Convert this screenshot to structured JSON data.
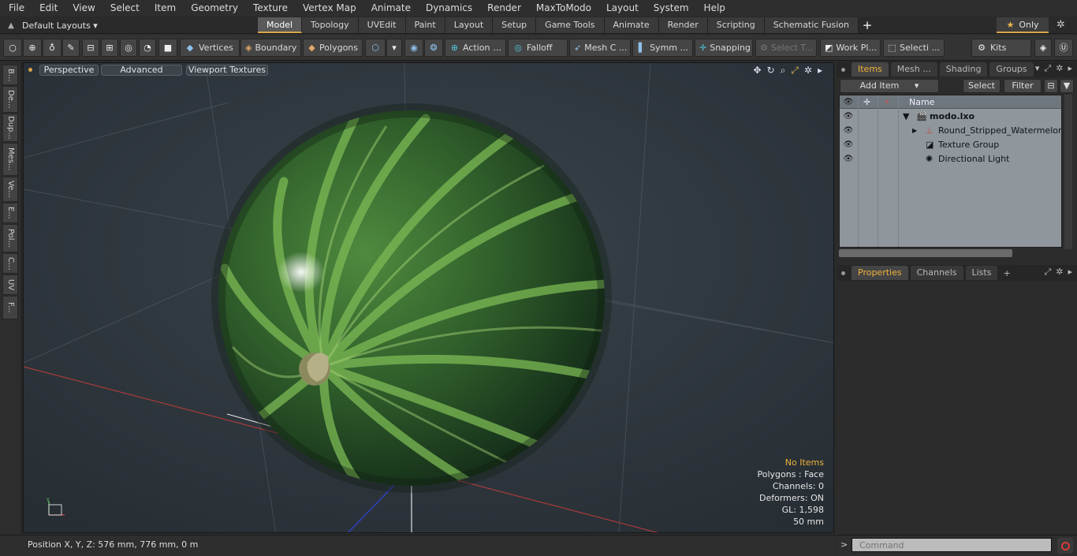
{
  "menu": [
    "File",
    "Edit",
    "View",
    "Select",
    "Item",
    "Geometry",
    "Texture",
    "Vertex Map",
    "Animate",
    "Dynamics",
    "Render",
    "MaxToModo",
    "Layout",
    "System",
    "Help"
  ],
  "layout_menu": {
    "label": "Default Layouts ▾",
    "icon": "layouts-home-icon"
  },
  "tabs": [
    {
      "label": "Model",
      "active": true
    },
    {
      "label": "Topology"
    },
    {
      "label": "UVEdit"
    },
    {
      "label": "Paint"
    },
    {
      "label": "Layout"
    },
    {
      "label": "Setup"
    },
    {
      "label": "Game Tools"
    },
    {
      "label": "Animate"
    },
    {
      "label": "Render"
    },
    {
      "label": "Scripting"
    },
    {
      "label": "Schematic Fusion"
    }
  ],
  "tab_add": "+",
  "only_button": {
    "star": "★",
    "label": "Only"
  },
  "toolbar": {
    "vertices": "Vertices",
    "boundary": "Boundary",
    "polygons": "Polygons",
    "action": "Action",
    "falloff": "Falloff",
    "mesh": "Mesh C ...",
    "symmetry": "Symm ...",
    "snapping": "Snapping",
    "select_through": "Select T...",
    "work_plane": "Work Pl...",
    "selection": "Selecti ...",
    "kits": "Kits",
    "action_more": "..."
  },
  "left_tabs": [
    "B...",
    "De...",
    "Dup...",
    "Mes...",
    "Ve...",
    "E...",
    "Pol...",
    "C...",
    "UV",
    "F..."
  ],
  "viewport": {
    "view_mode": "Perspective",
    "shading": "Advanced",
    "textures": "Viewport Textures",
    "info": {
      "no_items": "No Items",
      "polygons": "Polygons : Face",
      "channels": "Channels: 0",
      "deformers": "Deformers: ON",
      "gl": "GL: 1,598",
      "size": "50 mm"
    },
    "colors": {
      "accent": "#d8a64a",
      "warning": "#f0b23b",
      "background": "#2a3137"
    }
  },
  "status": {
    "position": "Position X, Y, Z:   576 mm, 776 mm, 0 m"
  },
  "items_panel": {
    "tabs": [
      {
        "label": "Items",
        "active": true
      },
      {
        "label": "Mesh ..."
      },
      {
        "label": "Shading"
      },
      {
        "label": "Groups"
      }
    ],
    "add_item": "Add Item",
    "select": "Select",
    "filter": "Filter",
    "column_name": "Name",
    "rows": [
      {
        "label": "modo.lxo",
        "icon": "scene-icon",
        "expand": "▼"
      },
      {
        "label": "Round_Stripped_Watermelon...",
        "icon": "locator-icon",
        "expand": "▶"
      },
      {
        "label": "Texture Group",
        "icon": "texture-group-icon",
        "expand": ""
      },
      {
        "label": "Directional Light",
        "icon": "light-icon",
        "expand": ""
      }
    ]
  },
  "properties_panel": {
    "tabs": [
      {
        "label": "Properties",
        "active": true
      },
      {
        "label": "Channels"
      },
      {
        "label": "Lists"
      }
    ],
    "add": "+"
  },
  "command": {
    "prompt": ">",
    "placeholder": "Command"
  }
}
